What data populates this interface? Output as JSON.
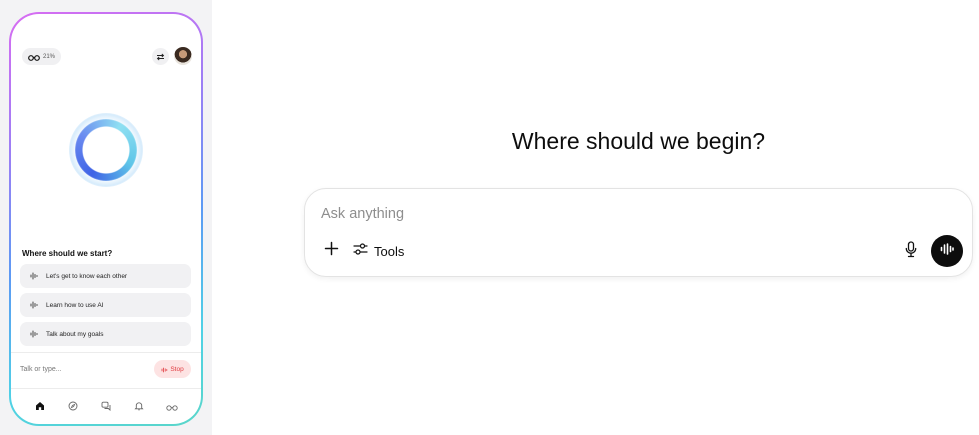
{
  "phone": {
    "usage_percent": "21%",
    "prompt_title": "Where should we start?",
    "suggestions": [
      {
        "label": "Let's get to know each other"
      },
      {
        "label": "Learn how to use AI"
      },
      {
        "label": "Talk about my goals"
      }
    ],
    "input_placeholder": "Talk or type...",
    "stop_label": "Stop",
    "tabs": [
      "home-icon",
      "compass-icon",
      "chat-icon",
      "bell-icon",
      "glasses-icon"
    ]
  },
  "main": {
    "headline": "Where should we begin?",
    "composer": {
      "placeholder": "Ask anything",
      "tools_label": "Tools"
    }
  },
  "colors": {
    "accent_gradient_start": "#d86cf2",
    "accent_gradient_end": "#5ad6c9",
    "stop_red": "#e0393e",
    "voice_button_bg": "#0d0d0d"
  }
}
